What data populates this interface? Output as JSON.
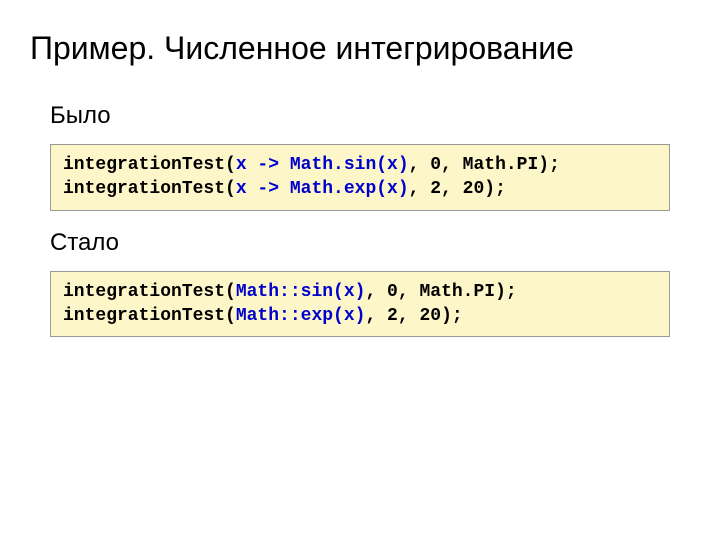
{
  "title": "Пример. Численное интегрирование",
  "section_before": "Было",
  "section_after": "Стало",
  "code_before": {
    "l1_p1": "integrationTest(",
    "l1_lambda": "x -> Math.sin(x)",
    "l1_p2": ", 0, Math.PI);",
    "l2_p1": "integrationTest(",
    "l2_lambda": "x -> Math.exp(x)",
    "l2_p2": ", 2, 20);"
  },
  "code_after": {
    "l1_p1": "integrationTest(",
    "l1_ref": "Math::sin(x)",
    "l1_p2": ", 0, Math.PI);",
    "l2_p1": "integrationTest(",
    "l2_ref": "Math::exp(x)",
    "l2_p2": ", 2, 20);"
  }
}
